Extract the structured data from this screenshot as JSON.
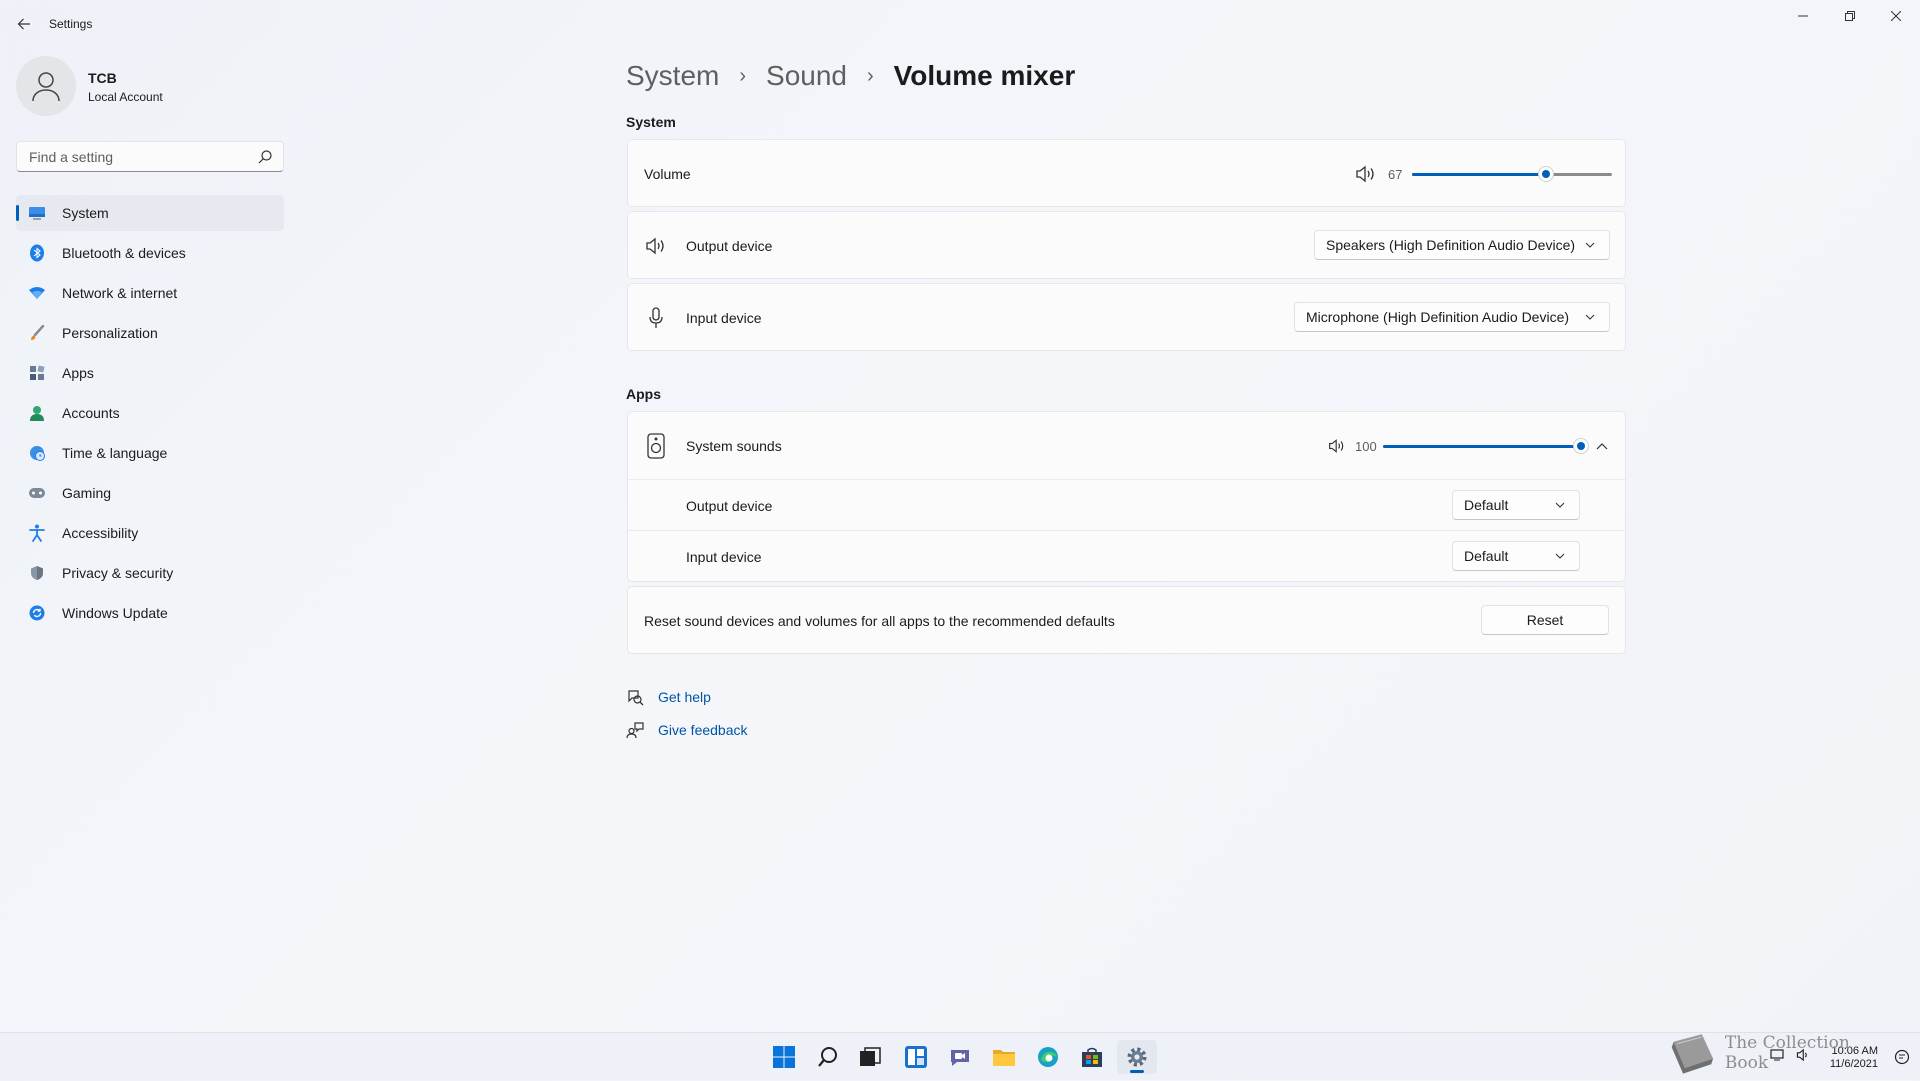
{
  "window": {
    "title": "Settings"
  },
  "profile": {
    "name": "TCB",
    "account_type": "Local Account"
  },
  "search": {
    "placeholder": "Find a setting"
  },
  "nav": {
    "items": [
      {
        "label": "System",
        "icon": "monitor-icon",
        "active": true
      },
      {
        "label": "Bluetooth & devices",
        "icon": "bluetooth-icon"
      },
      {
        "label": "Network & internet",
        "icon": "wifi-icon"
      },
      {
        "label": "Personalization",
        "icon": "brush-icon"
      },
      {
        "label": "Apps",
        "icon": "apps-icon"
      },
      {
        "label": "Accounts",
        "icon": "person-icon"
      },
      {
        "label": "Time & language",
        "icon": "globe-clock-icon"
      },
      {
        "label": "Gaming",
        "icon": "gamepad-icon"
      },
      {
        "label": "Accessibility",
        "icon": "accessibility-icon"
      },
      {
        "label": "Privacy & security",
        "icon": "shield-icon"
      },
      {
        "label": "Windows Update",
        "icon": "update-icon"
      }
    ]
  },
  "breadcrumb": {
    "level1": "System",
    "level2": "Sound",
    "current": "Volume mixer"
  },
  "system_section": {
    "title": "System",
    "volume": {
      "label": "Volume",
      "value": "67",
      "level": 67
    },
    "output": {
      "label": "Output device",
      "selected": "Speakers (High Definition Audio Device)"
    },
    "input": {
      "label": "Input device",
      "selected": "Microphone (High Definition Audio Device)"
    }
  },
  "apps_section": {
    "title": "Apps",
    "system_sounds": {
      "label": "System sounds",
      "value": "100",
      "level": 100,
      "output": {
        "label": "Output device",
        "selected": "Default"
      },
      "input": {
        "label": "Input device",
        "selected": "Default"
      }
    },
    "reset": {
      "label": "Reset sound devices and volumes for all apps to the recommended defaults",
      "button": "Reset"
    }
  },
  "help": {
    "get_help": "Get help",
    "give_feedback": "Give feedback"
  },
  "taskbar": {
    "apps": [
      "start-icon",
      "search-icon",
      "task-view-icon",
      "widgets-icon",
      "chat-icon",
      "file-explorer-icon",
      "edge-icon",
      "store-icon",
      "settings-icon"
    ],
    "time": "10:06 AM",
    "date": "11/6/2021"
  },
  "watermark": {
    "text": "The Collection Book"
  },
  "colors": {
    "accent": "#005fb8",
    "link": "#0054a6",
    "background": "#f3f5f9",
    "card": "#fbfbfc"
  }
}
